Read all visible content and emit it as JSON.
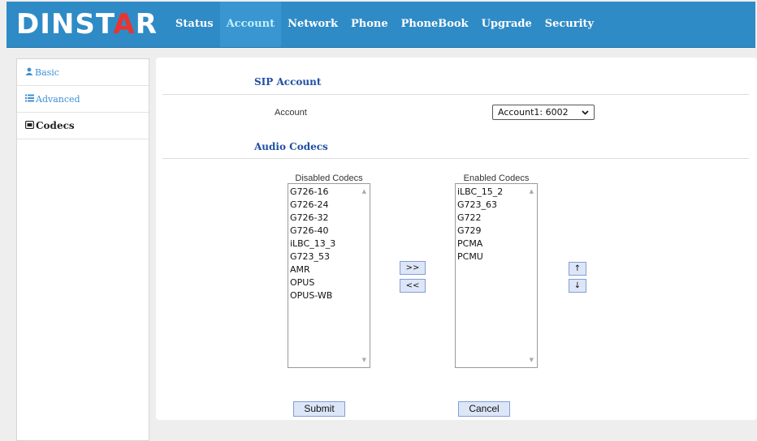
{
  "brand": {
    "logo_left": "DINST",
    "logo_accent": "A",
    "logo_right": "R"
  },
  "nav": {
    "items": [
      "Status",
      "Account",
      "Network",
      "Phone",
      "PhoneBook",
      "Upgrade",
      "Security"
    ],
    "active": "Account"
  },
  "sidebar": {
    "items": [
      {
        "label": "Basic",
        "icon": "user-icon"
      },
      {
        "label": "Advanced",
        "icon": "list-icon"
      },
      {
        "label": "Codecs",
        "icon": "codec-icon"
      }
    ]
  },
  "sip": {
    "title": "SIP Account",
    "account_label": "Account",
    "account_value": "Account1: 6002"
  },
  "codecs": {
    "title": "Audio Codecs",
    "disabled_caption": "Disabled Codecs",
    "enabled_caption": "Enabled Codecs",
    "disabled": [
      "G726-16",
      "G726-24",
      "G726-32",
      "G726-40",
      "iLBC_13_3",
      "G723_53",
      "AMR",
      "OPUS",
      "OPUS-WB"
    ],
    "enabled": [
      "iLBC_15_2",
      "G723_63",
      "G722",
      "G729",
      "PCMA",
      "PCMU"
    ],
    "move_right": ">>",
    "move_left": "<<",
    "move_up": "↑",
    "move_down": "↓"
  },
  "actions": {
    "submit": "Submit",
    "cancel": "Cancel"
  },
  "colors": {
    "header": "#2f8bc6",
    "logo_accent": "#e9342f",
    "active_nav": "#bff0ff",
    "section_title": "#1f4fa3",
    "side_link": "#3f8fd6"
  }
}
